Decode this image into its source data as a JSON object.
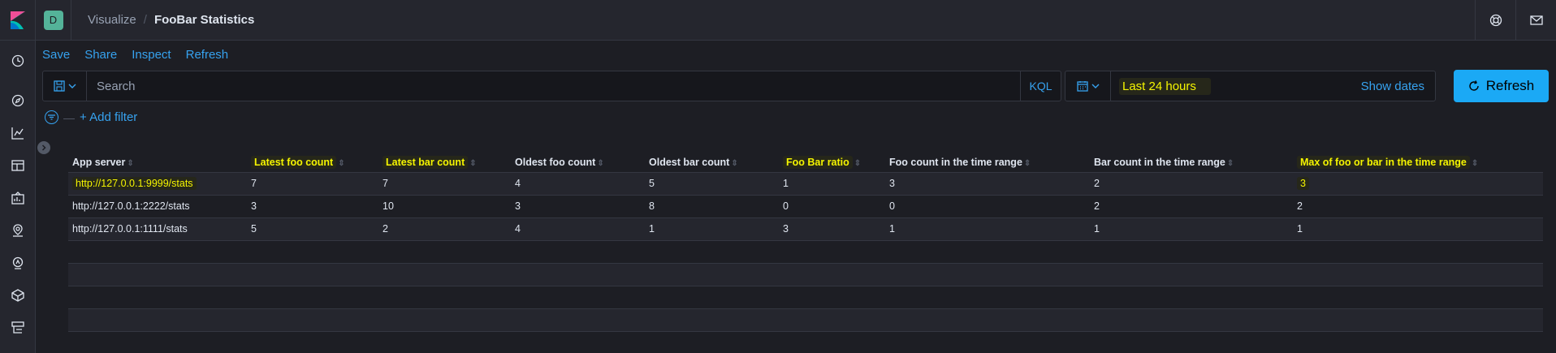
{
  "header": {
    "space_initial": "D",
    "breadcrumbs": [
      "Visualize",
      "FooBar Statistics"
    ]
  },
  "top_menu": [
    "Save",
    "Share",
    "Inspect",
    "Refresh"
  ],
  "query_bar": {
    "placeholder": "Search",
    "language_label": "KQL"
  },
  "date_picker": {
    "range_label": "Last 24 hours",
    "show_dates_label": "Show dates"
  },
  "refresh_button_label": "Refresh",
  "filters": {
    "add_label": "+ Add filter"
  },
  "table": {
    "columns": [
      {
        "label": "App server",
        "highlighted": false
      },
      {
        "label": "Latest foo count",
        "highlighted": true
      },
      {
        "label": "Latest bar count",
        "highlighted": true
      },
      {
        "label": "Oldest foo count",
        "highlighted": false
      },
      {
        "label": "Oldest bar count",
        "highlighted": false
      },
      {
        "label": "Foo Bar ratio",
        "highlighted": true
      },
      {
        "label": "Foo count in the time range",
        "highlighted": false
      },
      {
        "label": "Bar count in the time range",
        "highlighted": false
      },
      {
        "label": "Max of foo or bar in the time range",
        "highlighted": true
      }
    ],
    "rows": [
      [
        "http://127.0.0.1:9999/stats",
        "7",
        "7",
        "4",
        "5",
        "1",
        "3",
        "2",
        "3"
      ],
      [
        "http://127.0.0.1:2222/stats",
        "3",
        "10",
        "3",
        "8",
        "0",
        "0",
        "2",
        "2"
      ],
      [
        "http://127.0.0.1:1111/stats",
        "5",
        "2",
        "4",
        "1",
        "3",
        "1",
        "1",
        "1"
      ]
    ],
    "highlighted_cells": [
      [
        0,
        0
      ],
      [
        0,
        8
      ]
    ]
  },
  "colors": {
    "accent": "#36a2ef",
    "refresh_bg": "#1ba9f5",
    "highlight_text": "#f5f500",
    "background": "#1d1e24"
  }
}
